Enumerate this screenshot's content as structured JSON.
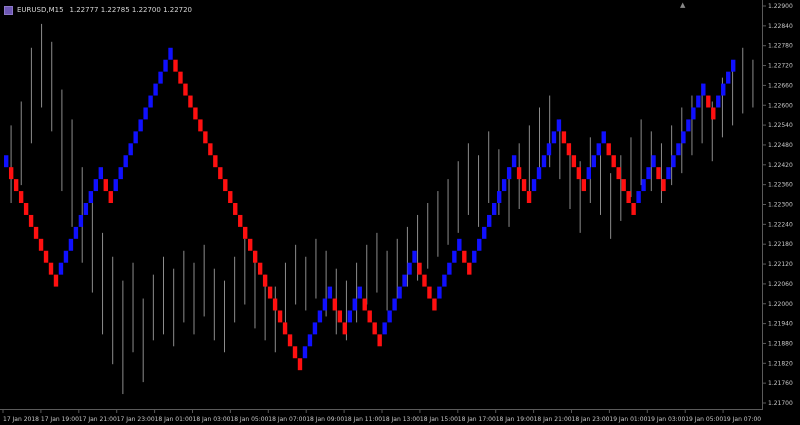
{
  "window": {
    "symbol": "EURUSD,M15",
    "ohlc": "1.22777 1.22785 1.22700 1.22720",
    "colors": {
      "background": "#000000",
      "bull_brick": "#1010ff",
      "bear_brick": "#ff1010",
      "bars": "#8c8c8c",
      "text": "#d6d6d6"
    }
  },
  "chart_data": {
    "type": "renko_overlay_on_bars",
    "symbol": "EURUSD",
    "timeframe": "M15",
    "ylim": [
      1.2162,
      1.2297
    ],
    "y_ticks": [
      "1.22900",
      "1.22840",
      "1.22780",
      "1.22720",
      "1.22660",
      "1.22600",
      "1.22540",
      "1.22480",
      "1.22420",
      "1.22360",
      "1.22300",
      "1.22240",
      "1.22180",
      "1.22120",
      "1.22060",
      "1.22000",
      "1.21940",
      "1.21880",
      "1.21820",
      "1.21760",
      "1.21700"
    ],
    "x_labels": [
      "17 Jan 2018",
      "17 Jan 19:00",
      "17 Jan 21:00",
      "17 Jan 23:00",
      "18 Jan 01:00",
      "18 Jan 03:00",
      "18 Jan 05:00",
      "18 Jan 07:00",
      "18 Jan 09:00",
      "18 Jan 11:00",
      "18 Jan 13:00",
      "18 Jan 15:00",
      "18 Jan 17:00",
      "18 Jan 19:00",
      "18 Jan 21:00",
      "18 Jan 23:00",
      "19 Jan 01:00",
      "19 Jan 03:00",
      "19 Jan 05:00",
      "19 Jan 07:00"
    ],
    "brick_size": 0.0004,
    "renko_bricks": [
      {
        "dir": "up",
        "low": 1.2242,
        "high": 1.2246
      },
      {
        "dir": "down",
        "low": 1.2238,
        "high": 1.2242
      },
      {
        "dir": "down",
        "low": 1.2234,
        "high": 1.2238
      },
      {
        "dir": "down",
        "low": 1.223,
        "high": 1.2234
      },
      {
        "dir": "down",
        "low": 1.2226,
        "high": 1.223
      },
      {
        "dir": "down",
        "low": 1.2222,
        "high": 1.2226
      },
      {
        "dir": "down",
        "low": 1.2218,
        "high": 1.2222
      },
      {
        "dir": "down",
        "low": 1.2214,
        "high": 1.2218
      },
      {
        "dir": "down",
        "low": 1.221,
        "high": 1.2214
      },
      {
        "dir": "down",
        "low": 1.2206,
        "high": 1.221
      },
      {
        "dir": "down",
        "low": 1.2202,
        "high": 1.2206
      },
      {
        "dir": "up",
        "low": 1.2206,
        "high": 1.221
      },
      {
        "dir": "up",
        "low": 1.221,
        "high": 1.2214
      },
      {
        "dir": "up",
        "low": 1.2214,
        "high": 1.2218
      },
      {
        "dir": "up",
        "low": 1.2218,
        "high": 1.2222
      },
      {
        "dir": "up",
        "low": 1.2222,
        "high": 1.2226
      },
      {
        "dir": "up",
        "low": 1.2226,
        "high": 1.223
      },
      {
        "dir": "up",
        "low": 1.223,
        "high": 1.2234
      },
      {
        "dir": "up",
        "low": 1.2234,
        "high": 1.2238
      },
      {
        "dir": "up",
        "low": 1.2238,
        "high": 1.2242
      },
      {
        "dir": "down",
        "low": 1.2234,
        "high": 1.2238
      },
      {
        "dir": "down",
        "low": 1.223,
        "high": 1.2234
      },
      {
        "dir": "up",
        "low": 1.2234,
        "high": 1.2238
      },
      {
        "dir": "up",
        "low": 1.2238,
        "high": 1.2242
      },
      {
        "dir": "up",
        "low": 1.2242,
        "high": 1.2246
      },
      {
        "dir": "up",
        "low": 1.2246,
        "high": 1.225
      },
      {
        "dir": "up",
        "low": 1.225,
        "high": 1.2254
      },
      {
        "dir": "up",
        "low": 1.2254,
        "high": 1.2258
      },
      {
        "dir": "up",
        "low": 1.2258,
        "high": 1.2262
      },
      {
        "dir": "up",
        "low": 1.2262,
        "high": 1.2266
      },
      {
        "dir": "up",
        "low": 1.2266,
        "high": 1.227
      },
      {
        "dir": "up",
        "low": 1.227,
        "high": 1.2274
      },
      {
        "dir": "up",
        "low": 1.2274,
        "high": 1.2278
      },
      {
        "dir": "up",
        "low": 1.2278,
        "high": 1.2282
      },
      {
        "dir": "down",
        "low": 1.2274,
        "high": 1.2278
      },
      {
        "dir": "down",
        "low": 1.227,
        "high": 1.2274
      },
      {
        "dir": "down",
        "low": 1.2266,
        "high": 1.227
      },
      {
        "dir": "down",
        "low": 1.2262,
        "high": 1.2266
      },
      {
        "dir": "down",
        "low": 1.2258,
        "high": 1.2262
      },
      {
        "dir": "down",
        "low": 1.2254,
        "high": 1.2258
      },
      {
        "dir": "down",
        "low": 1.225,
        "high": 1.2254
      },
      {
        "dir": "down",
        "low": 1.2246,
        "high": 1.225
      },
      {
        "dir": "down",
        "low": 1.2242,
        "high": 1.2246
      },
      {
        "dir": "down",
        "low": 1.2238,
        "high": 1.2242
      },
      {
        "dir": "down",
        "low": 1.2234,
        "high": 1.2238
      },
      {
        "dir": "down",
        "low": 1.223,
        "high": 1.2234
      },
      {
        "dir": "down",
        "low": 1.2226,
        "high": 1.223
      },
      {
        "dir": "down",
        "low": 1.2222,
        "high": 1.2226
      },
      {
        "dir": "down",
        "low": 1.2218,
        "high": 1.2222
      },
      {
        "dir": "down",
        "low": 1.2214,
        "high": 1.2218
      },
      {
        "dir": "down",
        "low": 1.221,
        "high": 1.2214
      },
      {
        "dir": "down",
        "low": 1.2206,
        "high": 1.221
      },
      {
        "dir": "down",
        "low": 1.2202,
        "high": 1.2206
      },
      {
        "dir": "down",
        "low": 1.2198,
        "high": 1.2202
      },
      {
        "dir": "down",
        "low": 1.2194,
        "high": 1.2198
      },
      {
        "dir": "down",
        "low": 1.219,
        "high": 1.2194
      },
      {
        "dir": "down",
        "low": 1.2186,
        "high": 1.219
      },
      {
        "dir": "down",
        "low": 1.2182,
        "high": 1.2186
      },
      {
        "dir": "down",
        "low": 1.2178,
        "high": 1.2182
      },
      {
        "dir": "down",
        "low": 1.2174,
        "high": 1.2178
      },
      {
        "dir": "up",
        "low": 1.2178,
        "high": 1.2182
      },
      {
        "dir": "up",
        "low": 1.2182,
        "high": 1.2186
      },
      {
        "dir": "up",
        "low": 1.2186,
        "high": 1.219
      },
      {
        "dir": "up",
        "low": 1.219,
        "high": 1.2194
      },
      {
        "dir": "up",
        "low": 1.2194,
        "high": 1.2198
      },
      {
        "dir": "up",
        "low": 1.2198,
        "high": 1.2202
      },
      {
        "dir": "down",
        "low": 1.2194,
        "high": 1.2198
      },
      {
        "dir": "down",
        "low": 1.219,
        "high": 1.2194
      },
      {
        "dir": "down",
        "low": 1.2186,
        "high": 1.219
      },
      {
        "dir": "up",
        "low": 1.219,
        "high": 1.2194
      },
      {
        "dir": "up",
        "low": 1.2194,
        "high": 1.2198
      },
      {
        "dir": "up",
        "low": 1.2198,
        "high": 1.2202
      },
      {
        "dir": "down",
        "low": 1.2194,
        "high": 1.2198
      },
      {
        "dir": "down",
        "low": 1.219,
        "high": 1.2194
      },
      {
        "dir": "down",
        "low": 1.2186,
        "high": 1.219
      },
      {
        "dir": "down",
        "low": 1.2182,
        "high": 1.2186
      },
      {
        "dir": "up",
        "low": 1.2186,
        "high": 1.219
      },
      {
        "dir": "up",
        "low": 1.219,
        "high": 1.2194
      },
      {
        "dir": "up",
        "low": 1.2194,
        "high": 1.2198
      },
      {
        "dir": "up",
        "low": 1.2198,
        "high": 1.2202
      },
      {
        "dir": "up",
        "low": 1.2202,
        "high": 1.2206
      },
      {
        "dir": "up",
        "low": 1.2206,
        "high": 1.221
      },
      {
        "dir": "up",
        "low": 1.221,
        "high": 1.2214
      },
      {
        "dir": "down",
        "low": 1.2206,
        "high": 1.221
      },
      {
        "dir": "down",
        "low": 1.2202,
        "high": 1.2206
      },
      {
        "dir": "down",
        "low": 1.2198,
        "high": 1.2202
      },
      {
        "dir": "down",
        "low": 1.2194,
        "high": 1.2198
      },
      {
        "dir": "up",
        "low": 1.2198,
        "high": 1.2202
      },
      {
        "dir": "up",
        "low": 1.2202,
        "high": 1.2206
      },
      {
        "dir": "up",
        "low": 1.2206,
        "high": 1.221
      },
      {
        "dir": "up",
        "low": 1.221,
        "high": 1.2214
      },
      {
        "dir": "up",
        "low": 1.2214,
        "high": 1.2218
      },
      {
        "dir": "down",
        "low": 1.221,
        "high": 1.2214
      },
      {
        "dir": "down",
        "low": 1.2206,
        "high": 1.221
      },
      {
        "dir": "up",
        "low": 1.221,
        "high": 1.2214
      },
      {
        "dir": "up",
        "low": 1.2214,
        "high": 1.2218
      },
      {
        "dir": "up",
        "low": 1.2218,
        "high": 1.2222
      },
      {
        "dir": "up",
        "low": 1.2222,
        "high": 1.2226
      },
      {
        "dir": "up",
        "low": 1.2226,
        "high": 1.223
      },
      {
        "dir": "up",
        "low": 1.223,
        "high": 1.2234
      },
      {
        "dir": "up",
        "low": 1.2234,
        "high": 1.2238
      },
      {
        "dir": "up",
        "low": 1.2238,
        "high": 1.2242
      },
      {
        "dir": "up",
        "low": 1.2242,
        "high": 1.2246
      },
      {
        "dir": "down",
        "low": 1.2238,
        "high": 1.2242
      },
      {
        "dir": "down",
        "low": 1.2234,
        "high": 1.2238
      },
      {
        "dir": "down",
        "low": 1.223,
        "high": 1.2234
      },
      {
        "dir": "up",
        "low": 1.2234,
        "high": 1.2238
      },
      {
        "dir": "up",
        "low": 1.2238,
        "high": 1.2242
      },
      {
        "dir": "up",
        "low": 1.2242,
        "high": 1.2246
      },
      {
        "dir": "up",
        "low": 1.2246,
        "high": 1.225
      },
      {
        "dir": "up",
        "low": 1.225,
        "high": 1.2254
      },
      {
        "dir": "up",
        "low": 1.2254,
        "high": 1.2258
      },
      {
        "dir": "down",
        "low": 1.225,
        "high": 1.2254
      },
      {
        "dir": "down",
        "low": 1.2246,
        "high": 1.225
      },
      {
        "dir": "down",
        "low": 1.2242,
        "high": 1.2246
      },
      {
        "dir": "down",
        "low": 1.2238,
        "high": 1.2242
      },
      {
        "dir": "down",
        "low": 1.2234,
        "high": 1.2238
      },
      {
        "dir": "up",
        "low": 1.2238,
        "high": 1.2242
      },
      {
        "dir": "up",
        "low": 1.2242,
        "high": 1.2246
      },
      {
        "dir": "up",
        "low": 1.2246,
        "high": 1.225
      },
      {
        "dir": "up",
        "low": 1.225,
        "high": 1.2254
      },
      {
        "dir": "down",
        "low": 1.2246,
        "high": 1.225
      },
      {
        "dir": "down",
        "low": 1.2242,
        "high": 1.2246
      },
      {
        "dir": "down",
        "low": 1.2238,
        "high": 1.2242
      },
      {
        "dir": "down",
        "low": 1.2234,
        "high": 1.2238
      },
      {
        "dir": "down",
        "low": 1.223,
        "high": 1.2234
      },
      {
        "dir": "down",
        "low": 1.2226,
        "high": 1.223
      },
      {
        "dir": "up",
        "low": 1.223,
        "high": 1.2234
      },
      {
        "dir": "up",
        "low": 1.2234,
        "high": 1.2238
      },
      {
        "dir": "up",
        "low": 1.2238,
        "high": 1.2242
      },
      {
        "dir": "up",
        "low": 1.2242,
        "high": 1.2246
      },
      {
        "dir": "down",
        "low": 1.2238,
        "high": 1.2242
      },
      {
        "dir": "down",
        "low": 1.2234,
        "high": 1.2238
      },
      {
        "dir": "up",
        "low": 1.2238,
        "high": 1.2242
      },
      {
        "dir": "up",
        "low": 1.2242,
        "high": 1.2246
      },
      {
        "dir": "up",
        "low": 1.2246,
        "high": 1.225
      },
      {
        "dir": "up",
        "low": 1.225,
        "high": 1.2254
      },
      {
        "dir": "up",
        "low": 1.2254,
        "high": 1.2258
      },
      {
        "dir": "up",
        "low": 1.2258,
        "high": 1.2262
      },
      {
        "dir": "up",
        "low": 1.2262,
        "high": 1.2266
      },
      {
        "dir": "up",
        "low": 1.2266,
        "high": 1.227
      },
      {
        "dir": "down",
        "low": 1.2262,
        "high": 1.2266
      },
      {
        "dir": "down",
        "low": 1.2258,
        "high": 1.2262
      },
      {
        "dir": "up",
        "low": 1.2262,
        "high": 1.2266
      },
      {
        "dir": "up",
        "low": 1.2266,
        "high": 1.227
      },
      {
        "dir": "up",
        "low": 1.227,
        "high": 1.2274
      },
      {
        "dir": "up",
        "low": 1.2274,
        "high": 1.2278
      }
    ],
    "bars": [
      {
        "high": 1.2256,
        "low": 1.223
      },
      {
        "high": 1.2264,
        "low": 1.2236
      },
      {
        "high": 1.2282,
        "low": 1.225
      },
      {
        "high": 1.229,
        "low": 1.2262
      },
      {
        "high": 1.2284,
        "low": 1.2254
      },
      {
        "high": 1.2268,
        "low": 1.2234
      },
      {
        "high": 1.2258,
        "low": 1.2222
      },
      {
        "high": 1.2242,
        "low": 1.221
      },
      {
        "high": 1.223,
        "low": 1.22
      },
      {
        "high": 1.222,
        "low": 1.2186
      },
      {
        "high": 1.2212,
        "low": 1.2176
      },
      {
        "high": 1.2204,
        "low": 1.2166
      },
      {
        "high": 1.221,
        "low": 1.218
      },
      {
        "high": 1.2198,
        "low": 1.217
      },
      {
        "high": 1.2206,
        "low": 1.2184
      },
      {
        "high": 1.2212,
        "low": 1.2186
      },
      {
        "high": 1.2208,
        "low": 1.2182
      },
      {
        "high": 1.2214,
        "low": 1.219
      },
      {
        "high": 1.221,
        "low": 1.2186
      },
      {
        "high": 1.2216,
        "low": 1.2192
      },
      {
        "high": 1.2208,
        "low": 1.2184
      },
      {
        "high": 1.2204,
        "low": 1.218
      },
      {
        "high": 1.2212,
        "low": 1.219
      },
      {
        "high": 1.2218,
        "low": 1.2196
      },
      {
        "high": 1.2214,
        "low": 1.2188
      },
      {
        "high": 1.2206,
        "low": 1.2184
      },
      {
        "high": 1.2202,
        "low": 1.218
      },
      {
        "high": 1.221,
        "low": 1.219
      },
      {
        "high": 1.2216,
        "low": 1.2196
      },
      {
        "high": 1.2212,
        "low": 1.2194
      },
      {
        "high": 1.2218,
        "low": 1.2198
      },
      {
        "high": 1.2214,
        "low": 1.2192
      },
      {
        "high": 1.2208,
        "low": 1.2186
      },
      {
        "high": 1.2204,
        "low": 1.2184
      },
      {
        "high": 1.221,
        "low": 1.219
      },
      {
        "high": 1.2216,
        "low": 1.2196
      },
      {
        "high": 1.222,
        "low": 1.22
      },
      {
        "high": 1.2214,
        "low": 1.2194
      },
      {
        "high": 1.2218,
        "low": 1.2198
      },
      {
        "high": 1.2222,
        "low": 1.2202
      },
      {
        "high": 1.2226,
        "low": 1.2204
      },
      {
        "high": 1.223,
        "low": 1.2208
      },
      {
        "high": 1.2234,
        "low": 1.2212
      },
      {
        "high": 1.2238,
        "low": 1.2216
      },
      {
        "high": 1.2244,
        "low": 1.222
      },
      {
        "high": 1.225,
        "low": 1.2226
      },
      {
        "high": 1.2246,
        "low": 1.2222
      },
      {
        "high": 1.2254,
        "low": 1.223
      },
      {
        "high": 1.2248,
        "low": 1.2226
      },
      {
        "high": 1.2242,
        "low": 1.2222
      },
      {
        "high": 1.225,
        "low": 1.2228
      },
      {
        "high": 1.2256,
        "low": 1.2234
      },
      {
        "high": 1.2262,
        "low": 1.2238
      },
      {
        "high": 1.2266,
        "low": 1.2242
      },
      {
        "high": 1.2258,
        "low": 1.2238
      },
      {
        "high": 1.225,
        "low": 1.2228
      },
      {
        "high": 1.2244,
        "low": 1.222
      },
      {
        "high": 1.2252,
        "low": 1.223
      },
      {
        "high": 1.2246,
        "low": 1.2226
      },
      {
        "high": 1.224,
        "low": 1.2218
      },
      {
        "high": 1.2246,
        "low": 1.2224
      },
      {
        "high": 1.2252,
        "low": 1.2232
      },
      {
        "high": 1.2258,
        "low": 1.2236
      },
      {
        "high": 1.2254,
        "low": 1.2234
      },
      {
        "high": 1.225,
        "low": 1.223
      },
      {
        "high": 1.2256,
        "low": 1.2236
      },
      {
        "high": 1.2262,
        "low": 1.224
      },
      {
        "high": 1.2266,
        "low": 1.2246
      },
      {
        "high": 1.227,
        "low": 1.225
      },
      {
        "high": 1.2264,
        "low": 1.2244
      },
      {
        "high": 1.2272,
        "low": 1.2252
      },
      {
        "high": 1.2276,
        "low": 1.2256
      },
      {
        "high": 1.2282,
        "low": 1.226
      },
      {
        "high": 1.2278,
        "low": 1.2262
      }
    ]
  }
}
